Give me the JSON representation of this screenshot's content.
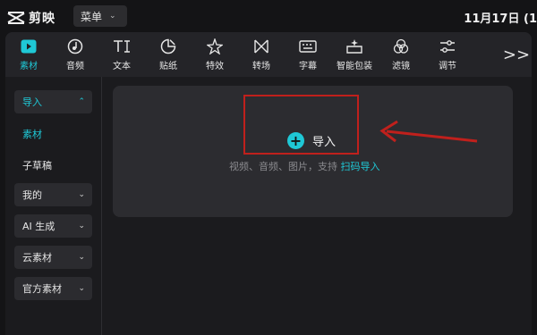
{
  "app": {
    "name": "剪映",
    "menu_label": "菜单",
    "date": "11月17日 (1"
  },
  "toolbar": {
    "tabs": [
      {
        "label": "素材",
        "icon": "play-media-icon",
        "active": true
      },
      {
        "label": "音频",
        "icon": "music-note-icon"
      },
      {
        "label": "文本",
        "icon": "text-tool-icon"
      },
      {
        "label": "贴纸",
        "icon": "sticker-icon"
      },
      {
        "label": "特效",
        "icon": "sparkle-star-icon"
      },
      {
        "label": "转场",
        "icon": "transition-bowtie-icon"
      },
      {
        "label": "字幕",
        "icon": "subtitle-keyboard-icon"
      },
      {
        "label": "智能包装",
        "icon": "magic-package-icon"
      },
      {
        "label": "滤镜",
        "icon": "filter-circles-icon"
      },
      {
        "label": "调节",
        "icon": "adjust-sliders-icon"
      }
    ],
    "more_label": ">>"
  },
  "sidebar": {
    "items": [
      {
        "label": "导入",
        "expanded": true
      },
      {
        "label": "素材"
      },
      {
        "label": "子草稿"
      },
      {
        "label": "我的"
      },
      {
        "label": "AI 生成"
      },
      {
        "label": "云素材"
      },
      {
        "label": "官方素材"
      }
    ]
  },
  "main": {
    "import_label": "导入",
    "hint_text": "视频、音频、图片，支持",
    "hint_link": "扫码导入"
  },
  "colors": {
    "accent": "#1fc8d6",
    "annotation": "#c0201c",
    "background": "#141416"
  }
}
